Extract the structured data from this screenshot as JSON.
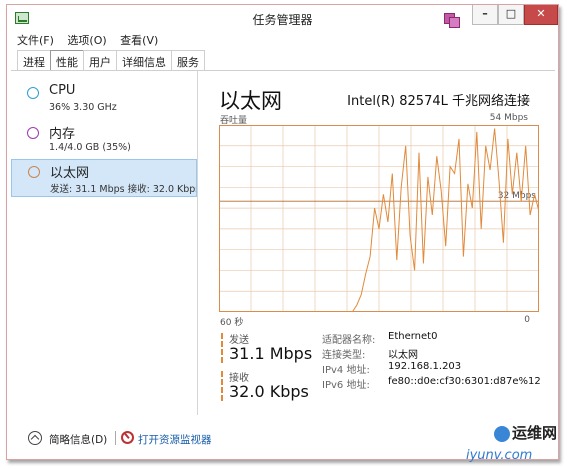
{
  "window": {
    "title": "任务管理器"
  },
  "menu": [
    "文件(F)",
    "选项(O)",
    "查看(V)"
  ],
  "tabs": [
    {
      "label": "进程",
      "active": false
    },
    {
      "label": "性能",
      "active": true
    },
    {
      "label": "用户",
      "active": false
    },
    {
      "label": "详细信息",
      "active": false
    },
    {
      "label": "服务",
      "active": false
    }
  ],
  "sidebar": {
    "items": [
      {
        "title": "CPU",
        "sub": "36% 3.30 GHz",
        "ring_color": "#2f9fd6",
        "selected": false
      },
      {
        "title": "内存",
        "sub": "1.4/4.0 GB (35%)",
        "ring_color": "#9b3bb3",
        "selected": false
      },
      {
        "title": "以太网",
        "sub": "发送: 31.1 Mbps 接收: 32.0 Kbps",
        "ring_color": "#c88550",
        "selected": true
      }
    ]
  },
  "main": {
    "title": "以太网",
    "adapter": "Intel(R) 82574L 千兆网络连接",
    "graph": {
      "top_left_label": "吞吐量",
      "top_right_label": "54 Mbps",
      "mid_right_label": "32 Mbps",
      "bottom_left_label": "60 秒",
      "bottom_right_label": "0",
      "line_color": "#e08a3c",
      "grid_color": "#e9c9ae",
      "border_color": "#d98e4f",
      "max_value": 54,
      "samples": [
        0,
        0,
        0,
        0,
        0,
        0,
        0,
        0,
        0,
        0,
        0,
        0,
        0,
        0,
        0,
        0,
        0,
        0,
        0,
        0,
        0,
        0,
        0,
        0,
        0,
        0,
        0,
        0,
        0,
        0,
        0,
        2,
        5,
        11,
        16,
        30,
        24,
        34,
        26,
        40,
        15,
        36,
        48,
        22,
        12,
        46,
        14,
        39,
        28,
        45,
        35,
        19,
        42,
        40,
        50,
        16,
        37,
        30,
        52,
        24,
        48,
        41,
        53,
        38,
        20,
        50,
        34,
        46,
        32,
        48,
        28,
        34,
        29
      ]
    },
    "send": {
      "label": "发送",
      "value": "31.1 Mbps"
    },
    "receive": {
      "label": "接收",
      "value": "32.0 Kbps"
    },
    "info": [
      {
        "key": "适配器名称:",
        "value": "Ethernet0"
      },
      {
        "key": "连接类型:",
        "value": "以太网"
      },
      {
        "key": "IPv4 地址:",
        "value": "192.168.1.203"
      },
      {
        "key": "IPv6 地址:",
        "value": "fe80::d0e:cf30:6301:d87e%12"
      }
    ]
  },
  "footer": {
    "fewer_details": "简略信息(D)",
    "open_monitor": "打开资源监视器"
  },
  "watermark": {
    "name": "运维网",
    "url": "iyunv.com"
  }
}
